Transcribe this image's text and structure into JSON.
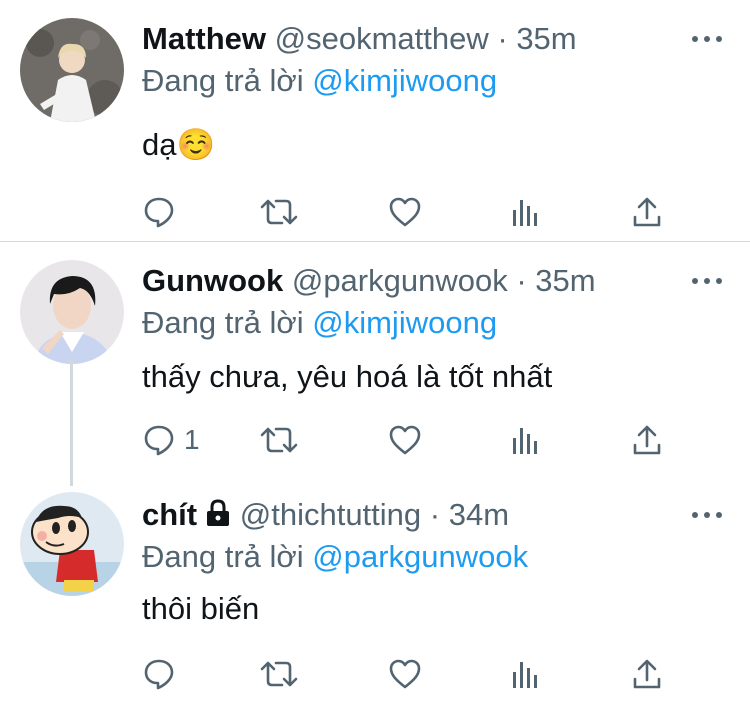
{
  "tweets": [
    {
      "name": "Matthew",
      "handle": "@seokmatthew",
      "sep": "·",
      "time": "35m",
      "replying_prefix": "Đang trả lời",
      "replying_to": "@kimjiwoong",
      "text": "dạ☺️",
      "reply_count": "",
      "avatar_colors": {
        "bg": "#6f6b66",
        "shirt": "#f2f2f2",
        "hair": "#e8d8b0"
      }
    },
    {
      "name": "Gunwook",
      "handle": "@parkgunwook",
      "sep": "·",
      "time": "35m",
      "replying_prefix": "Đang trả lời",
      "replying_to": "@kimjiwoong",
      "text": "thấy chưa, yêu hoá là tốt nhất",
      "reply_count": "1",
      "avatar_colors": {
        "bg": "#e9e6ea",
        "shirt": "#c9d4f0",
        "hair": "#1a1a1a"
      }
    },
    {
      "name": "chít",
      "handle": "@thichtutting",
      "sep": "·",
      "time": "34m",
      "replying_prefix": "Đang trả lời",
      "replying_to": "@parkgunwook",
      "text": "thôi biến",
      "reply_count": "",
      "protected_icon": "lock-icon",
      "avatar_colors": {
        "bg": "#dfe9f2",
        "shirt": "#d62b2b",
        "pants": "#f3d24a"
      }
    }
  ],
  "icons": {
    "reply": "reply-icon",
    "retweet": "retweet-icon",
    "like": "heart-icon",
    "views": "analytics-icon",
    "share": "share-icon",
    "more": "more-icon"
  },
  "colors": {
    "accent": "#1d9bf0",
    "secondary_text": "#536471",
    "divider": "#cfd9de"
  }
}
